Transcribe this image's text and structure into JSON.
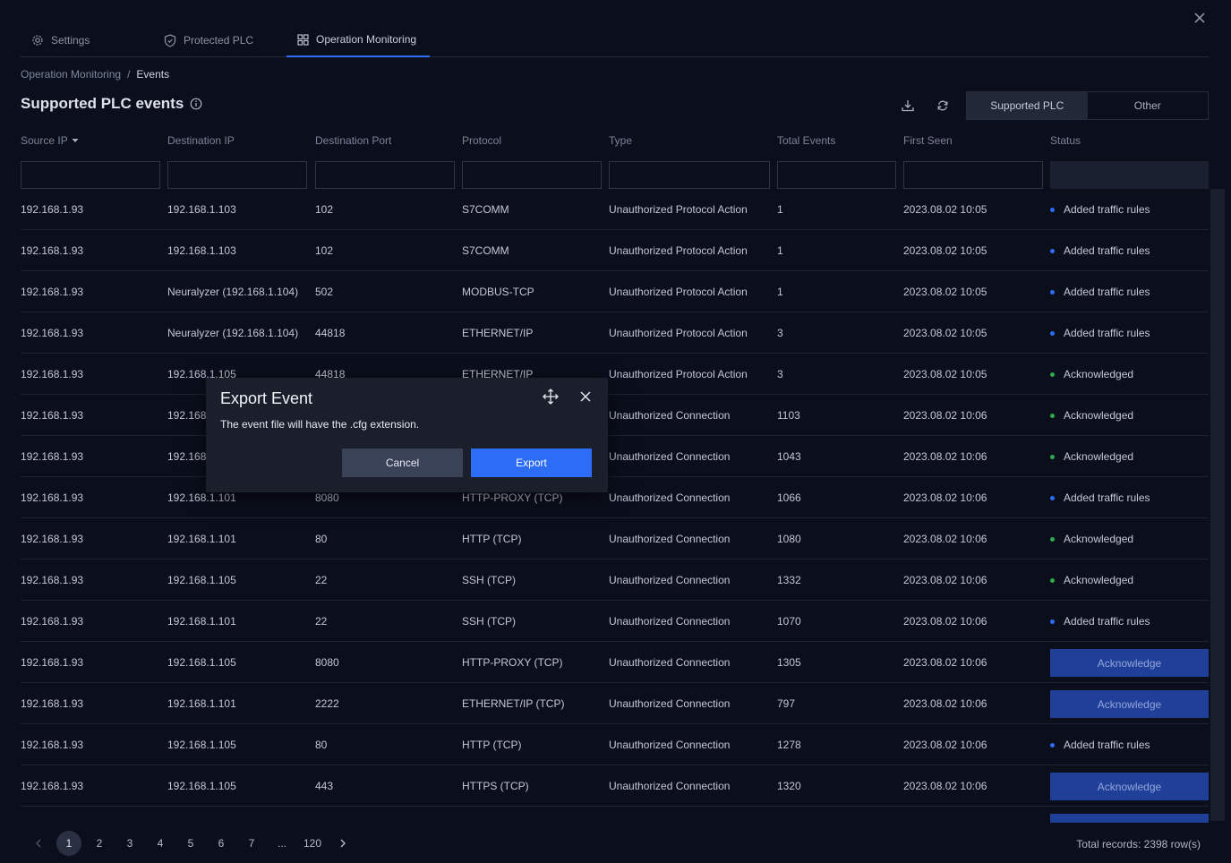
{
  "tabs": [
    {
      "label": "Settings",
      "icon": "gear-icon"
    },
    {
      "label": "Protected PLC",
      "icon": "shield-icon"
    },
    {
      "label": "Operation Monitoring",
      "icon": "dashboard-icon"
    }
  ],
  "breadcrumb": {
    "parent": "Operation Monitoring",
    "separator": "/",
    "current": "Events"
  },
  "page_title": "Supported PLC events",
  "segment": {
    "options": [
      "Supported PLC",
      "Other"
    ],
    "selected": "Supported PLC"
  },
  "columns": [
    "Source IP",
    "Destination IP",
    "Destination Port",
    "Protocol",
    "Type",
    "Total Events",
    "First Seen",
    "Status"
  ],
  "colors": {
    "accent": "#2d6cf5",
    "status_blue": "#2f6bff",
    "status_green": "#2fa84f",
    "ack_button": "#1f3f99"
  },
  "rows": [
    {
      "src": "192.168.1.93",
      "dst": "192.168.1.103",
      "port": "102",
      "proto": "S7COMM",
      "type": "Unauthorized Protocol Action",
      "total": "1",
      "first": "2023.08.02 10:05",
      "status": "Added traffic rules",
      "kind": "blue"
    },
    {
      "src": "192.168.1.93",
      "dst": "192.168.1.103",
      "port": "102",
      "proto": "S7COMM",
      "type": "Unauthorized Protocol Action",
      "total": "1",
      "first": "2023.08.02 10:05",
      "status": "Added traffic rules",
      "kind": "blue"
    },
    {
      "src": "192.168.1.93",
      "dst": "Neuralyzer (192.168.1.104)",
      "port": "502",
      "proto": "MODBUS-TCP",
      "type": "Unauthorized Protocol Action",
      "total": "1",
      "first": "2023.08.02 10:05",
      "status": "Added traffic rules",
      "kind": "blue"
    },
    {
      "src": "192.168.1.93",
      "dst": "Neuralyzer (192.168.1.104)",
      "port": "44818",
      "proto": "ETHERNET/IP",
      "type": "Unauthorized Protocol Action",
      "total": "3",
      "first": "2023.08.02 10:05",
      "status": "Added traffic rules",
      "kind": "blue"
    },
    {
      "src": "192.168.1.93",
      "dst": "192.168.1.105",
      "port": "44818",
      "proto": "ETHERNET/IP",
      "type": "Unauthorized Protocol Action",
      "total": "3",
      "first": "2023.08.02 10:05",
      "status": "Acknowledged",
      "kind": "green"
    },
    {
      "src": "192.168.1.93",
      "dst": "192.168",
      "port": "",
      "proto": "",
      "type": "Unauthorized Connection",
      "total": "1103",
      "first": "2023.08.02 10:06",
      "status": "Acknowledged",
      "kind": "green"
    },
    {
      "src": "192.168.1.93",
      "dst": "192.168",
      "port": "",
      "proto": "",
      "type": "Unauthorized Connection",
      "total": "1043",
      "first": "2023.08.02 10:06",
      "status": "Acknowledged",
      "kind": "green"
    },
    {
      "src": "192.168.1.93",
      "dst": "192.168.1.101",
      "port": "8080",
      "proto": "HTTP-PROXY (TCP)",
      "type": "Unauthorized Connection",
      "total": "1066",
      "first": "2023.08.02 10:06",
      "status": "Added traffic rules",
      "kind": "blue"
    },
    {
      "src": "192.168.1.93",
      "dst": "192.168.1.101",
      "port": "80",
      "proto": "HTTP (TCP)",
      "type": "Unauthorized Connection",
      "total": "1080",
      "first": "2023.08.02 10:06",
      "status": "Acknowledged",
      "kind": "green"
    },
    {
      "src": "192.168.1.93",
      "dst": "192.168.1.105",
      "port": "22",
      "proto": "SSH (TCP)",
      "type": "Unauthorized Connection",
      "total": "1332",
      "first": "2023.08.02 10:06",
      "status": "Acknowledged",
      "kind": "green"
    },
    {
      "src": "192.168.1.93",
      "dst": "192.168.1.101",
      "port": "22",
      "proto": "SSH (TCP)",
      "type": "Unauthorized Connection",
      "total": "1070",
      "first": "2023.08.02 10:06",
      "status": "Added traffic rules",
      "kind": "blue"
    },
    {
      "src": "192.168.1.93",
      "dst": "192.168.1.105",
      "port": "8080",
      "proto": "HTTP-PROXY (TCP)",
      "type": "Unauthorized Connection",
      "total": "1305",
      "first": "2023.08.02 10:06",
      "status": "Acknowledge",
      "kind": "button"
    },
    {
      "src": "192.168.1.93",
      "dst": "192.168.1.101",
      "port": "2222",
      "proto": "ETHERNET/IP (TCP)",
      "type": "Unauthorized Connection",
      "total": "797",
      "first": "2023.08.02 10:06",
      "status": "Acknowledge",
      "kind": "button"
    },
    {
      "src": "192.168.1.93",
      "dst": "192.168.1.105",
      "port": "80",
      "proto": "HTTP (TCP)",
      "type": "Unauthorized Connection",
      "total": "1278",
      "first": "2023.08.02 10:06",
      "status": "Added traffic rules",
      "kind": "blue"
    },
    {
      "src": "192.168.1.93",
      "dst": "192.168.1.105",
      "port": "443",
      "proto": "HTTPS (TCP)",
      "type": "Unauthorized Connection",
      "total": "1320",
      "first": "2023.08.02 10:06",
      "status": "Acknowledge",
      "kind": "button"
    },
    {
      "src": "",
      "dst": "",
      "port": "",
      "proto": "",
      "type": "",
      "total": "",
      "first": "",
      "status": "Acknowledge",
      "kind": "button"
    }
  ],
  "pagination": {
    "pages": [
      "1",
      "2",
      "3",
      "4",
      "5",
      "6",
      "7",
      "...",
      "120"
    ],
    "current": "1"
  },
  "total_records": "Total records: 2398 row(s)",
  "modal": {
    "title": "Export Event",
    "message": "The event file will have the .cfg extension.",
    "cancel_label": "Cancel",
    "export_label": "Export"
  }
}
